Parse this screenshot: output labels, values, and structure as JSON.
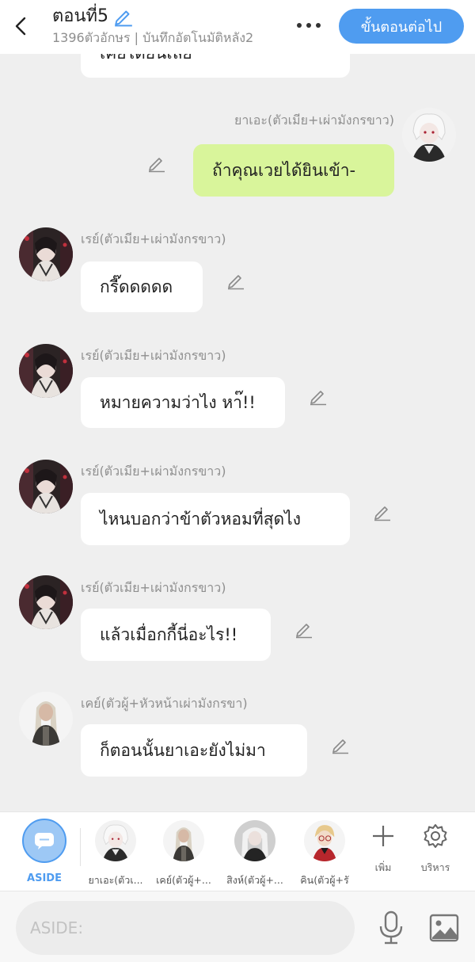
{
  "header": {
    "title": "ตอนที่5",
    "subtitle": "1396ตัวอักษร | บันทึกอัตโนมัติหลัง2",
    "next_button": "ขั้นตอนต่อไป"
  },
  "partial_top_message": "เคยได้ยินเลย",
  "messages": [
    {
      "name": "ยาเอะ(ตัวเมีย+เผ่ามังกรขาว)",
      "text": "ถ้าคุณเวยได้ยินเข้า-",
      "side": "right"
    },
    {
      "name": "เรย์(ตัวเมีย+เผ่ามังกรขาว)",
      "text": "กรี๊ดดดดด",
      "side": "left"
    },
    {
      "name": "เรย์(ตัวเมีย+เผ่ามังกรขาว)",
      "text": "หมายความว่าไง หา๊!!",
      "side": "left"
    },
    {
      "name": "เรย์(ตัวเมีย+เผ่ามังกรขาว)",
      "text": "ไหนบอกว่าข้าตัวหอมที่สุดไง",
      "side": "left"
    },
    {
      "name": "เรย์(ตัวเมีย+เผ่ามังกรขาว)",
      "text": "แล้วเมื่อกกี้นี่อะไร!!",
      "side": "left"
    },
    {
      "name": "เคย์(ตัวผู้+หัวหน้าเผ่ามังกรขา)",
      "text": "ก็ตอนนั้นยาเอะยังไม่มา",
      "side": "left"
    }
  ],
  "character_bar": {
    "aside_label": "ASIDE",
    "characters": [
      {
        "label": "ยาเอะ(ตัวเ..."
      },
      {
        "label": "เคย์(ตัวผู้+..."
      },
      {
        "label": "สิงห์(ตัวผู้+..."
      },
      {
        "label": "คิน(ตัวผู้+รั"
      }
    ],
    "add_label": "เพิ่ม",
    "manage_label": "บริหาร"
  },
  "input": {
    "placeholder": "ASIDE:"
  },
  "colors": {
    "accent": "#4f9cf0",
    "own_bubble": "#d9f59b",
    "background": "#efefef"
  }
}
